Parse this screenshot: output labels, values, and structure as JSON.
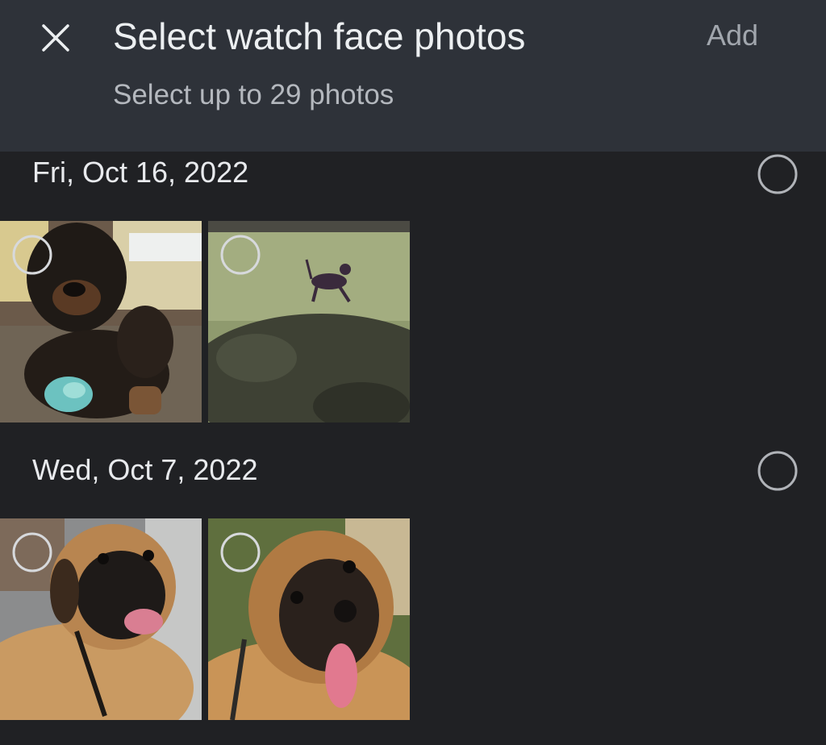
{
  "header": {
    "close_icon": "close-icon",
    "title": "Select watch face photos",
    "subtitle": "Select up to 29 photos",
    "add_label": "Add"
  },
  "sections": [
    {
      "date": "Fri, Oct 16, 2022",
      "photos": [
        {
          "subject": "rottweiler puppy on couch with toy",
          "selected": false
        },
        {
          "subject": "dog running on grass",
          "selected": false
        }
      ],
      "selected": false
    },
    {
      "date": "Wed, Oct 7, 2022",
      "photos": [
        {
          "subject": "mastiff dog close-up",
          "selected": false
        },
        {
          "subject": "mastiff dog with tongue out",
          "selected": false
        }
      ],
      "selected": false
    }
  ],
  "colors": {
    "header_bg": "#2e3239",
    "body_bg": "#202124",
    "text_primary": "#e8eaed",
    "text_secondary": "#b4b8be",
    "add_disabled": "#a1a6ad",
    "selector_ring": "#b0b3b8"
  }
}
